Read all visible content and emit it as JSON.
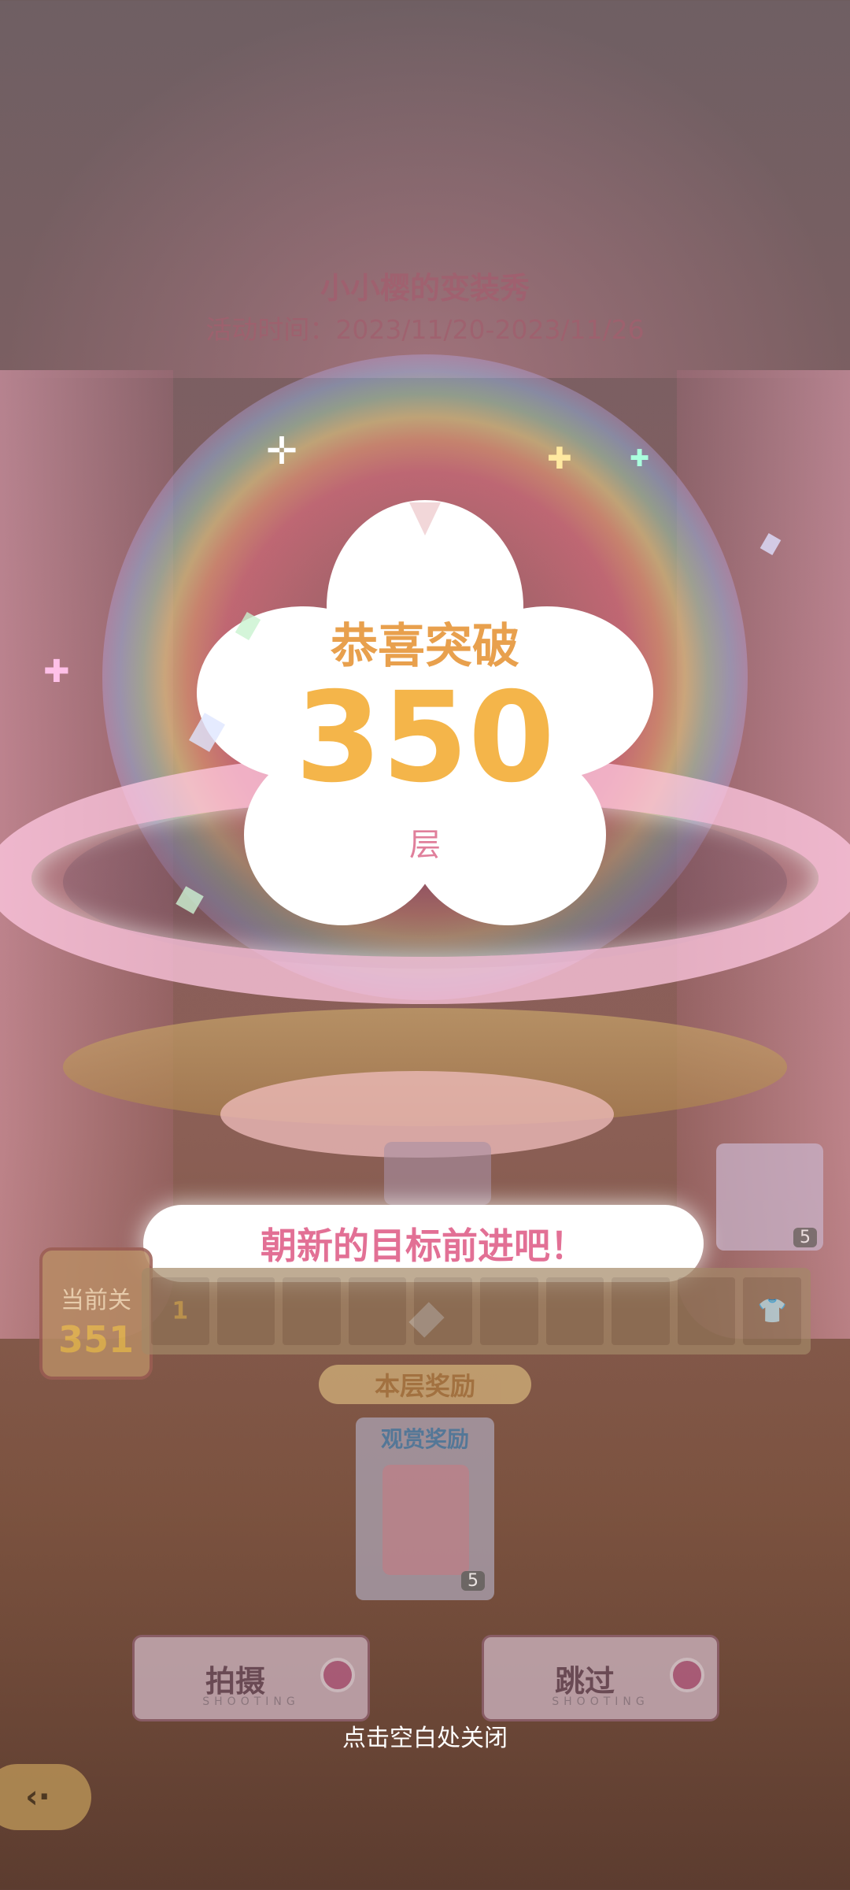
{
  "event": {
    "title": "小小樱的变装秀",
    "period": "活动时间：2023/11/20-2023/11/26"
  },
  "popup": {
    "congrats": "恭喜突破",
    "level": "350",
    "unit": "层",
    "banner": "朝新的目标前进吧！",
    "close_hint": "点击空白处关闭"
  },
  "progress": {
    "current_label": "当前关",
    "current_value": "351",
    "first_cell": "1",
    "reward_count_top": "5"
  },
  "floor_reward": {
    "title": "本层奖励",
    "watch_title": "观赏奖励",
    "watch_count": "5"
  },
  "buttons": {
    "shoot_label": "拍摄",
    "shoot_sub": "SHOOTING",
    "skip_label": "跳过",
    "skip_sub": "SHOOTING"
  },
  "icons": {
    "back": "back-arrow-icon",
    "sparkle": "sparkle-icon",
    "camera": "camera-lens-icon"
  },
  "colors": {
    "accent_pink": "#e27095",
    "gold": "#f4b54a"
  }
}
